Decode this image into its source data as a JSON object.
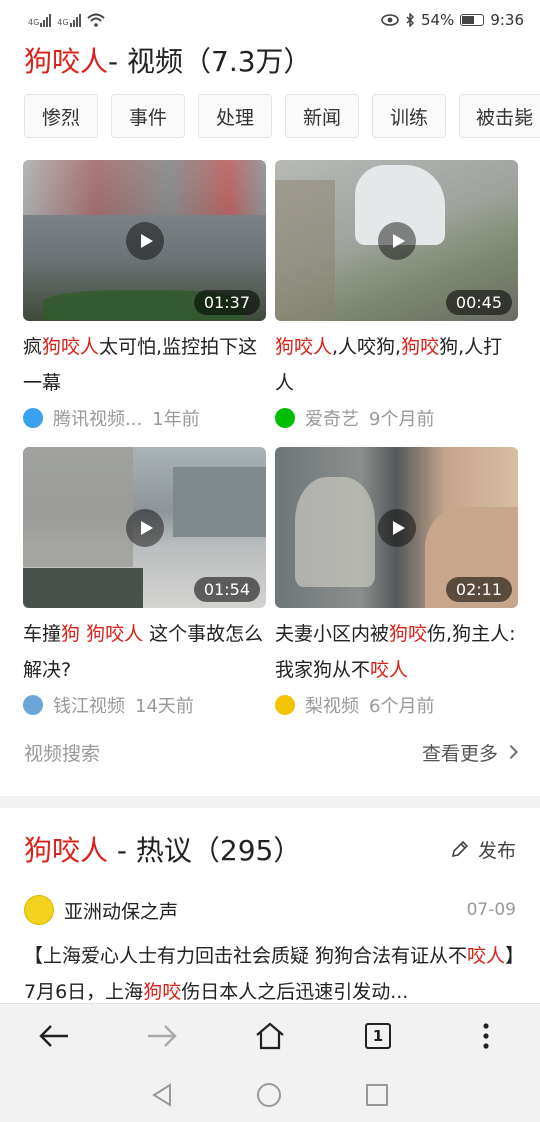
{
  "status": {
    "network1": "4G",
    "network2": "4G",
    "battery": "54%",
    "time": "9:36"
  },
  "video": {
    "keyword": "狗咬人",
    "rest": " - 视频（7.3万）",
    "chips": [
      "惨烈",
      "事件",
      "处理",
      "新闻",
      "训练",
      "被击毙"
    ],
    "cards": [
      {
        "duration": "01:37",
        "title": [
          {
            "t": "疯",
            "h": false
          },
          {
            "t": "狗咬人",
            "h": true
          },
          {
            "t": "太可怕,监控拍下这一幕",
            "h": false
          }
        ],
        "source": "腾讯视频...",
        "time": "1年前",
        "src_color": "#3aa0f0"
      },
      {
        "duration": "00:45",
        "title": [
          {
            "t": "狗咬人",
            "h": true
          },
          {
            "t": ",人咬狗,",
            "h": false
          },
          {
            "t": "狗咬",
            "h": true
          },
          {
            "t": "狗,人打人",
            "h": false
          }
        ],
        "source": "爱奇艺",
        "time": "9个月前",
        "src_color": "#00be06"
      },
      {
        "duration": "01:54",
        "title": [
          {
            "t": "车撞",
            "h": false
          },
          {
            "t": "狗",
            "h": true
          },
          {
            "t": " ",
            "h": false
          },
          {
            "t": "狗咬人",
            "h": true
          },
          {
            "t": " 这个事故怎么解决?",
            "h": false
          }
        ],
        "source": "钱江视频",
        "time": "14天前",
        "src_color": "#6aa7d8"
      },
      {
        "duration": "02:11",
        "title": [
          {
            "t": "夫妻小区内被",
            "h": false
          },
          {
            "t": "狗咬",
            "h": true
          },
          {
            "t": "伤,狗主人:我家狗从不",
            "h": false
          },
          {
            "t": "咬人",
            "h": true
          }
        ],
        "source": "梨视频",
        "time": "6个月前",
        "src_color": "#f5c400"
      }
    ],
    "search_label": "视频搜索",
    "more_label": "查看更多"
  },
  "discussion": {
    "keyword": "狗咬人",
    "rest": " - 热议（295）",
    "publish_label": "发布",
    "author": "亚洲动保之声",
    "date": "07-09",
    "post": [
      {
        "t": "【上海爱心人士有力回击社会质疑 狗狗合法有证从不",
        "h": false
      },
      {
        "t": "咬人",
        "h": true
      },
      {
        "t": "】7月6日，上海",
        "h": false
      },
      {
        "t": "狗咬",
        "h": true
      },
      {
        "t": "伤日本人之后迅速引发动...",
        "h": false
      }
    ]
  },
  "browser": {
    "tab_count": "1"
  }
}
